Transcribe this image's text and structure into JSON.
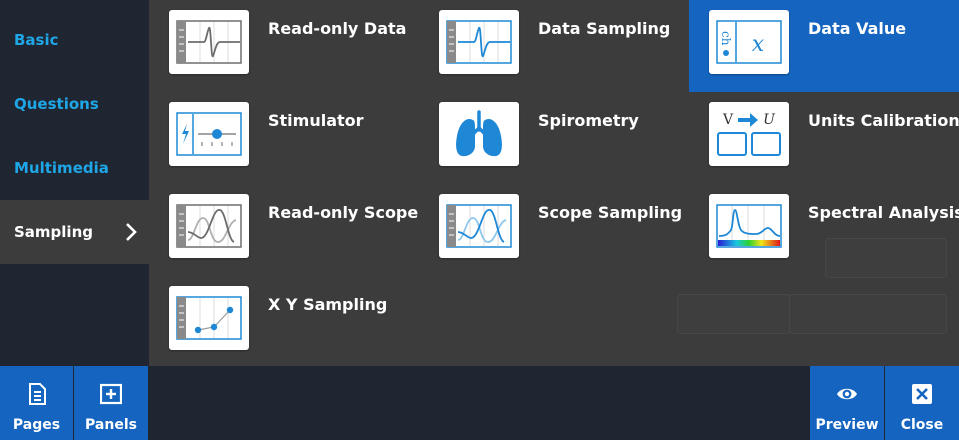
{
  "categories": [
    {
      "label": "Basic",
      "active": false
    },
    {
      "label": "Questions",
      "active": false
    },
    {
      "label": "Multimedia",
      "active": false
    },
    {
      "label": "Sampling",
      "active": true
    }
  ],
  "panels": [
    {
      "label": "Read-only Data",
      "icon": "read-only-data-icon",
      "selected": false
    },
    {
      "label": "Data Sampling",
      "icon": "data-sampling-icon",
      "selected": false
    },
    {
      "label": "Data Value",
      "icon": "data-value-icon",
      "selected": true
    },
    {
      "label": "Stimulator",
      "icon": "stimulator-icon",
      "selected": false
    },
    {
      "label": "Spirometry",
      "icon": "lungs-icon",
      "selected": false
    },
    {
      "label": "Units Calibration",
      "icon": "units-calibration-icon",
      "selected": false
    },
    {
      "label": "Read-only Scope",
      "icon": "read-only-scope-icon",
      "selected": false
    },
    {
      "label": "Scope Sampling",
      "icon": "scope-sampling-icon",
      "selected": false
    },
    {
      "label": "Spectral Analysis",
      "icon": "spectral-analysis-icon",
      "selected": false
    },
    {
      "label": "X Y Sampling",
      "icon": "xy-sampling-icon",
      "selected": false
    }
  ],
  "data_value_icon": {
    "symbol": "𝑥"
  },
  "units_icon": {
    "from": "V",
    "to": "U"
  },
  "toolbar": {
    "pages": "Pages",
    "panels": "Panels",
    "preview": "Preview",
    "close": "Close"
  },
  "colors": {
    "accent": "#1ea6e6",
    "selected": "#1565c0",
    "sidebar": "#202532",
    "grid": "#3c3c3c"
  }
}
